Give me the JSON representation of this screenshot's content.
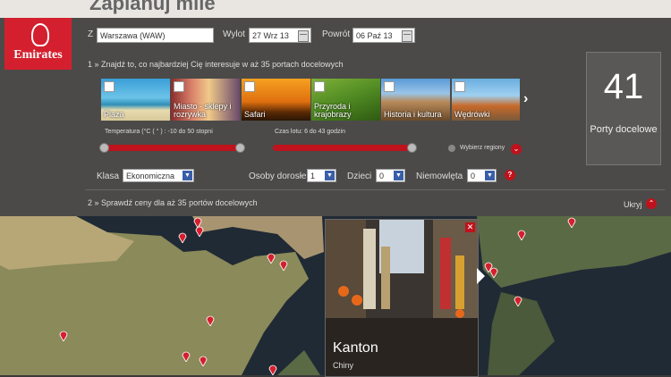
{
  "header": {
    "title": "Zaplanuj mile"
  },
  "logo": {
    "brand": "Emirates"
  },
  "search": {
    "from_label": "Z",
    "from_value": "Warszawa (WAW)",
    "depart_label": "Wylot",
    "depart_value": "27 Wrz 13",
    "return_label": "Powrót",
    "return_value": "06 Paź 13"
  },
  "step1": "1 » Znajdź to, co najbardziej Cię interesuje w aż 35 portach docelowych",
  "categories": [
    {
      "label": "Plaża"
    },
    {
      "label": "Miasto - sklepy i rozrywka"
    },
    {
      "label": "Safari"
    },
    {
      "label": "Przyroda i krajobrazy"
    },
    {
      "label": "Historia i kultura"
    },
    {
      "label": "Wędrówki"
    }
  ],
  "counter": {
    "number": "41",
    "caption": "Porty docelowe"
  },
  "filters": {
    "temp_label": "Temperatura (°C ( ° ) : -10 do 50 stopni",
    "time_label": "Czas lotu: 6 do 43 godzin",
    "regions_label": "Wybierz regiony",
    "class_label": "Klasa",
    "class_value": "Ekonomiczna",
    "adults_label": "Osoby dorosłe",
    "adults_value": "1",
    "children_label": "Dzieci",
    "children_value": "0",
    "infants_label": "Niemowlęta",
    "infants_value": "0"
  },
  "step2": "2 » Sprawdź ceny dla aż 35 portów docelowych",
  "hide_label": "Ukryj",
  "popup": {
    "city": "Kanton",
    "country": "Chiny"
  },
  "colors": {
    "accent": "#c0121c",
    "panel": "#4b4a48"
  }
}
